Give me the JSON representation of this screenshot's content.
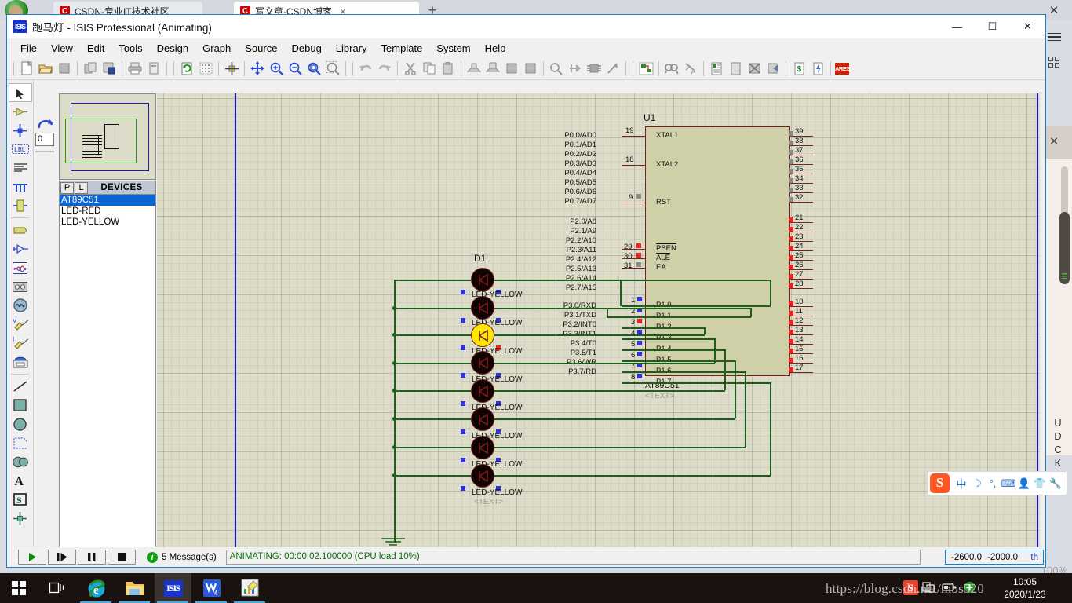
{
  "browser": {
    "tabs": [
      {
        "title": "CSDN-专业IT技术社区",
        "active": false,
        "favicon": "C"
      },
      {
        "title": "写文章-CSDN博客",
        "active": true,
        "favicon": "C"
      }
    ],
    "new_tab_label": "+",
    "close_label": "×",
    "sidebar_close_label": "×",
    "sidebar_vertical_text": "UDCKLG"
  },
  "window": {
    "title": "跑马灯 - ISIS Professional (Animating)",
    "icon_name": "isis-icon",
    "minimize_label": "—",
    "maximize_label": "☐",
    "close_label": "✕"
  },
  "menubar": {
    "items": [
      "File",
      "View",
      "Edit",
      "Tools",
      "Design",
      "Graph",
      "Source",
      "Debug",
      "Library",
      "Template",
      "System",
      "Help"
    ]
  },
  "toolbar": {
    "groups": [
      [
        "new-file-icon",
        "open-file-icon",
        "save-file-icon"
      ],
      [
        "import-section-icon",
        "export-section-icon"
      ],
      [
        "print-icon",
        "print-area-icon"
      ],
      [
        "refresh-display-icon",
        "toggle-grid-icon"
      ],
      [
        "origin-icon"
      ],
      [
        "pan-icon",
        "zoom-in-icon",
        "zoom-out-icon",
        "zoom-all-icon",
        "zoom-area-icon"
      ],
      [
        "undo-icon",
        "redo-icon"
      ],
      [
        "cut-icon",
        "copy-icon",
        "paste-icon"
      ],
      [
        "block-copy-icon",
        "block-move-icon",
        "block-rotate-icon",
        "block-delete-icon"
      ],
      [
        "pick-device-icon",
        "make-device-icon",
        "packaging-tool-icon",
        "decompose-icon"
      ],
      [
        "wire-autorouter-icon"
      ],
      [
        "search-tag-icon",
        "property-assign-icon"
      ],
      [
        "design-explorer-icon",
        "new-sheet-icon",
        "remove-sheet-icon",
        "exit-sheet-icon"
      ],
      [
        "bill-of-materials-icon",
        "electrical-rule-check-icon"
      ],
      [
        "ares-icon"
      ]
    ],
    "ares_label": "ARES"
  },
  "tool_palette": {
    "rotation_value": "0",
    "items": [
      {
        "name": "selection-mode-icon",
        "selected": true
      },
      {
        "name": "component-mode-icon",
        "selected": false
      },
      {
        "name": "junction-dot-mode-icon",
        "selected": false
      },
      {
        "name": "wire-label-mode-icon",
        "selected": false
      },
      {
        "name": "text-script-mode-icon",
        "selected": false
      },
      {
        "name": "bus-mode-icon",
        "selected": false
      },
      {
        "name": "subcircuit-mode-icon",
        "selected": false
      },
      {
        "name": "terminals-mode-icon",
        "selected": false
      },
      {
        "name": "device-pin-mode-icon",
        "selected": false
      },
      {
        "name": "graph-mode-icon",
        "selected": false
      },
      {
        "name": "tape-recorder-mode-icon",
        "selected": false
      },
      {
        "name": "generator-mode-icon",
        "selected": false
      },
      {
        "name": "voltage-probe-icon",
        "selected": false
      },
      {
        "name": "current-probe-icon",
        "selected": false
      },
      {
        "name": "virtual-instruments-icon",
        "selected": false
      },
      {
        "name": "line-tool-icon",
        "selected": false
      },
      {
        "name": "box-tool-icon",
        "selected": false
      },
      {
        "name": "circle-tool-icon",
        "selected": false
      },
      {
        "name": "arc-tool-icon",
        "selected": false
      },
      {
        "name": "closed-path-tool-icon",
        "selected": false
      },
      {
        "name": "text-tool-icon",
        "selected": false
      },
      {
        "name": "symbol-tool-icon",
        "selected": false
      },
      {
        "name": "marker-tool-icon",
        "selected": false
      }
    ]
  },
  "devices_panel": {
    "p_label": "P",
    "l_label": "L",
    "header": "DEVICES",
    "items": [
      {
        "label": "AT89C51",
        "selected": true
      },
      {
        "label": "LED-RED",
        "selected": false
      },
      {
        "label": "LED-YELLOW",
        "selected": false
      }
    ]
  },
  "schematic": {
    "mcu": {
      "reference": "U1",
      "part_name": "AT89C51",
      "text_placeholder": "<TEXT>",
      "left_pins": [
        {
          "num": "19",
          "label": "XTAL1",
          "state": "none"
        },
        {
          "num": "18",
          "label": "XTAL2",
          "state": "none"
        },
        {
          "num": "9",
          "label": "RST",
          "state": "gray"
        },
        {
          "num": "29",
          "label": "PSEN",
          "state": "red"
        },
        {
          "num": "30",
          "label": "ALE",
          "state": "red"
        },
        {
          "num": "31",
          "label": "EA",
          "state": "gray"
        },
        {
          "num": "1",
          "label": "P1.0",
          "state": "blue"
        },
        {
          "num": "2",
          "label": "P1.1",
          "state": "blue"
        },
        {
          "num": "3",
          "label": "P1.2",
          "state": "red"
        },
        {
          "num": "4",
          "label": "P1.3",
          "state": "blue"
        },
        {
          "num": "5",
          "label": "P1.4",
          "state": "blue"
        },
        {
          "num": "6",
          "label": "P1.5",
          "state": "blue"
        },
        {
          "num": "7",
          "label": "P1.6",
          "state": "blue"
        },
        {
          "num": "8",
          "label": "P1.7",
          "state": "blue"
        }
      ],
      "right_pins": [
        {
          "num": "39",
          "label": "P0.0/AD0",
          "state": "gray"
        },
        {
          "num": "38",
          "label": "P0.1/AD1",
          "state": "gray"
        },
        {
          "num": "37",
          "label": "P0.2/AD2",
          "state": "gray"
        },
        {
          "num": "36",
          "label": "P0.3/AD3",
          "state": "gray"
        },
        {
          "num": "35",
          "label": "P0.4/AD4",
          "state": "gray"
        },
        {
          "num": "34",
          "label": "P0.5/AD5",
          "state": "gray"
        },
        {
          "num": "33",
          "label": "P0.6/AD6",
          "state": "gray"
        },
        {
          "num": "32",
          "label": "P0.7/AD7",
          "state": "gray"
        },
        {
          "num": "21",
          "label": "P2.0/A8",
          "state": "red"
        },
        {
          "num": "22",
          "label": "P2.1/A9",
          "state": "red"
        },
        {
          "num": "23",
          "label": "P2.2/A10",
          "state": "red"
        },
        {
          "num": "24",
          "label": "P2.3/A11",
          "state": "red"
        },
        {
          "num": "25",
          "label": "P2.4/A12",
          "state": "red"
        },
        {
          "num": "26",
          "label": "P2.5/A13",
          "state": "red"
        },
        {
          "num": "27",
          "label": "P2.6/A14",
          "state": "red"
        },
        {
          "num": "28",
          "label": "P2.7/A15",
          "state": "red"
        },
        {
          "num": "10",
          "label": "P3.0/RXD",
          "state": "red"
        },
        {
          "num": "11",
          "label": "P3.1/TXD",
          "state": "red"
        },
        {
          "num": "12",
          "label": "P3.2/INT0",
          "state": "red"
        },
        {
          "num": "13",
          "label": "P3.3/INT1",
          "state": "red"
        },
        {
          "num": "14",
          "label": "P3.4/T0",
          "state": "red"
        },
        {
          "num": "15",
          "label": "P3.5/T1",
          "state": "red"
        },
        {
          "num": "16",
          "label": "P3.6/WR",
          "state": "red"
        },
        {
          "num": "17",
          "label": "P3.7/RD",
          "state": "red"
        }
      ]
    },
    "led_group": {
      "reference": "D1",
      "text_placeholder": "<TEXT>",
      "leds": [
        {
          "label": "LED-YELLOW",
          "lit": false,
          "right_state": "blue"
        },
        {
          "label": "LED-YELLOW",
          "lit": false,
          "right_state": "blue"
        },
        {
          "label": "LED-YELLOW",
          "lit": true,
          "right_state": "red"
        },
        {
          "label": "LED-YELLOW",
          "lit": false,
          "right_state": "blue"
        },
        {
          "label": "LED-YELLOW",
          "lit": false,
          "right_state": "blue"
        },
        {
          "label": "LED-YELLOW",
          "lit": false,
          "right_state": "blue"
        },
        {
          "label": "LED-YELLOW",
          "lit": false,
          "right_state": "blue"
        },
        {
          "label": "LED-YELLOW",
          "lit": false,
          "right_state": "blue"
        }
      ]
    }
  },
  "statusbar": {
    "play_label": "▶",
    "step_label": "▐▶",
    "pause_label": "❙❙",
    "stop_label": "■",
    "messages": "5 Message(s)",
    "messages_icon": "info-icon",
    "animation_status": "ANIMATING: 00:00:02.100000 (CPU load 10%)",
    "coord_x": "-2600.0",
    "coord_y": "-2000.0",
    "coord_unit": "th",
    "zoom_level": "100%"
  },
  "ime": {
    "logo": "S",
    "items": [
      "中",
      "☽",
      "°,",
      "⌨",
      "👤",
      "👕",
      "🔧"
    ],
    "item_names": [
      "chinese-mode-icon",
      "moon-icon",
      "punctuation-icon",
      "soft-keyboard-icon",
      "user-icon",
      "skin-icon",
      "settings-icon"
    ]
  },
  "taskbar": {
    "items": [
      {
        "name": "start-button",
        "label": "start-icon",
        "running": false
      },
      {
        "name": "task-view-button",
        "label": "task-view-icon",
        "running": false
      },
      {
        "name": "taskbar-ie",
        "label": "internet-explorer-icon",
        "running": true
      },
      {
        "name": "taskbar-explorer",
        "label": "file-explorer-icon",
        "running": true
      },
      {
        "name": "taskbar-isis",
        "label": "isis-icon",
        "running": true,
        "active": true
      },
      {
        "name": "taskbar-word",
        "label": "wps-writer-icon",
        "running": true
      },
      {
        "name": "taskbar-editor",
        "label": "markdown-editor-icon",
        "running": true
      }
    ],
    "tray": [
      "security-icon",
      "duplicate-icon",
      "battery-icon",
      "update-icon"
    ],
    "clock_time": "10:05",
    "clock_date": "2020/1/23",
    "watermark": "https://blog.csdn.net/mbs520"
  }
}
